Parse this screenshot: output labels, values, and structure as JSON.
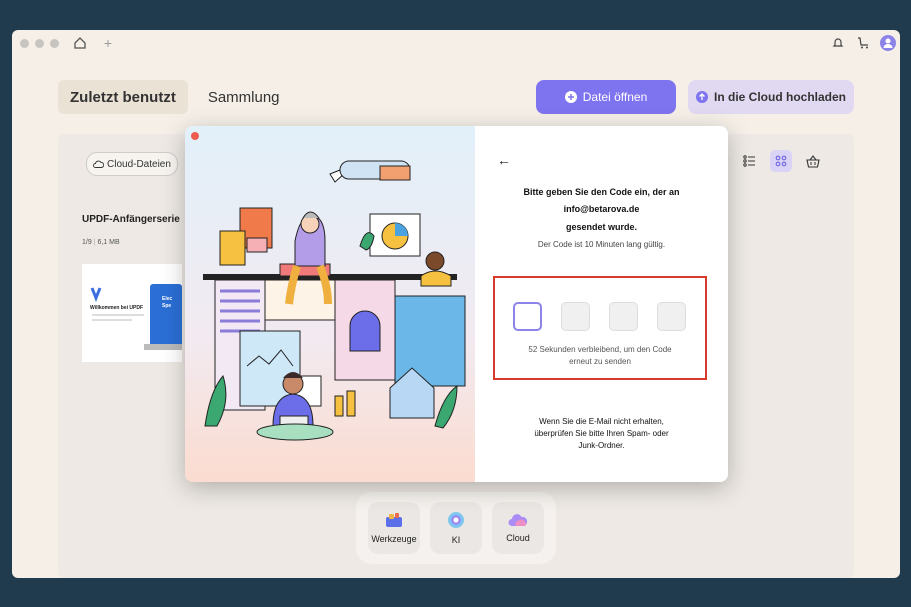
{
  "titlebar": {
    "home_icon": "home-icon",
    "new_tab": "+",
    "right_icons": [
      "bell-icon",
      "cart-icon",
      "user-avatar-icon"
    ]
  },
  "tabs": [
    {
      "label": "Zuletzt benutzt",
      "active": true
    },
    {
      "label": "Sammlung",
      "active": false
    }
  ],
  "actions": {
    "open_file": "Datei öffnen",
    "upload_cloud": "In die Cloud hochladen"
  },
  "content": {
    "cloud_chip": "Cloud-Dateien",
    "file_card": {
      "title": "UPDF-Anfängerserie",
      "pages": "1/9",
      "size": "6,1 MB",
      "thumb_heading": "Willkommen bei UPDF",
      "thumb_side": "Elec Spe"
    }
  },
  "dock": {
    "items": [
      {
        "label": "Werkzeuge",
        "icon": "tools-icon"
      },
      {
        "label": "KI",
        "icon": "ai-icon"
      },
      {
        "label": "Cloud",
        "icon": "cloud-icon"
      }
    ]
  },
  "modal": {
    "back": "←",
    "instruction_line1": "Bitte geben Sie den Code ein, der an",
    "instruction_email": "info@betarova.de",
    "instruction_line3": "gesendet wurde.",
    "validity": "Der Code ist 10 Minuten lang gültig.",
    "resend_line1": "52 Sekunden verbleibend, um den Code",
    "resend_line2": "erneut zu senden",
    "help_line1": "Wenn Sie die E-Mail nicht erhalten,",
    "help_line2": "überprüfen Sie bitte Ihren Spam- oder",
    "help_line3": "Junk-Ordner."
  },
  "colors": {
    "accent": "#7f74ef",
    "highlight": "#d73a2d",
    "close": "#ee5b4f"
  }
}
